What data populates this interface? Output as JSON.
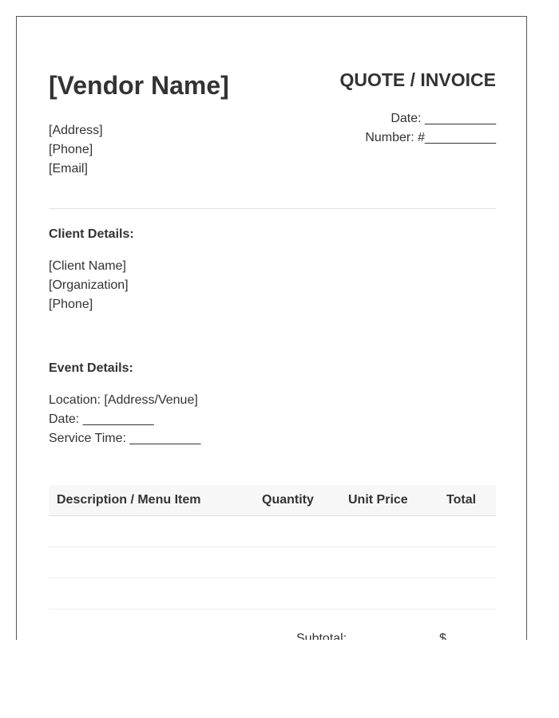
{
  "vendor": {
    "name": "[Vendor Name]",
    "address": "[Address]",
    "phone": "[Phone]",
    "email": "[Email]"
  },
  "document": {
    "title": "QUOTE / INVOICE",
    "date_line": "Date: __________",
    "number_line": "Number: #__________"
  },
  "client": {
    "heading": "Client Details:",
    "name": "[Client Name]",
    "organization": "[Organization]",
    "phone": "[Phone]"
  },
  "event": {
    "heading": "Event Details:",
    "location": "Location: [Address/Venue]",
    "date": "Date: __________",
    "service_time": "Service Time: __________"
  },
  "table": {
    "columns": [
      "Description / Menu Item",
      "Quantity",
      "Unit Price",
      "Total"
    ],
    "rows": [
      [
        "",
        "",
        "",
        ""
      ],
      [
        "",
        "",
        "",
        ""
      ],
      [
        "",
        "",
        "",
        ""
      ]
    ]
  },
  "totals": {
    "subtotal_label": "Subtotal:",
    "subtotal_value": "$"
  }
}
